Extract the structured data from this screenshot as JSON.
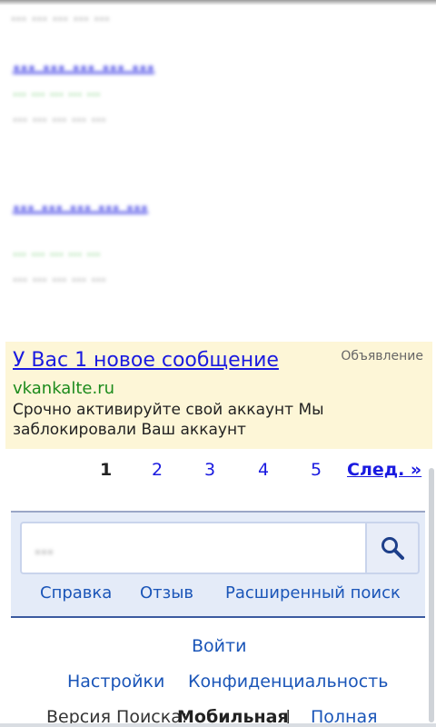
{
  "blurred_results": {
    "r0_snippet": "... ... ... ... ...",
    "r1_title": "... ... ... ... ...",
    "r1_url": "... ... ... ... ...",
    "r1_snippet": "... ... ... ... ...",
    "r2_title": "... ... ... ... ...",
    "r2_url": "... ... ... ... ...",
    "r2_snippet": "... ... ... ... ..."
  },
  "ad": {
    "title": "У Вас 1 новое сообщение",
    "label": "Объявление",
    "url": "vkankalte.ru",
    "text": "Срочно активируйте свой аккаунт Мы заблокировали Ваш аккаунт"
  },
  "pager": {
    "current": "1",
    "pages": [
      "2",
      "3",
      "4",
      "5"
    ],
    "next": "След. »"
  },
  "search": {
    "query": "...",
    "icon": "search-icon",
    "links": [
      "Справка",
      "Отзыв",
      "Расширенный поиск"
    ]
  },
  "footer": {
    "login": "Войти",
    "settings": "Настройки",
    "privacy": "Конфиденциальность",
    "version_label": "Версия Поиска:",
    "version_mobile": "Мобильная",
    "separator": "|",
    "version_full": "Полная"
  }
}
